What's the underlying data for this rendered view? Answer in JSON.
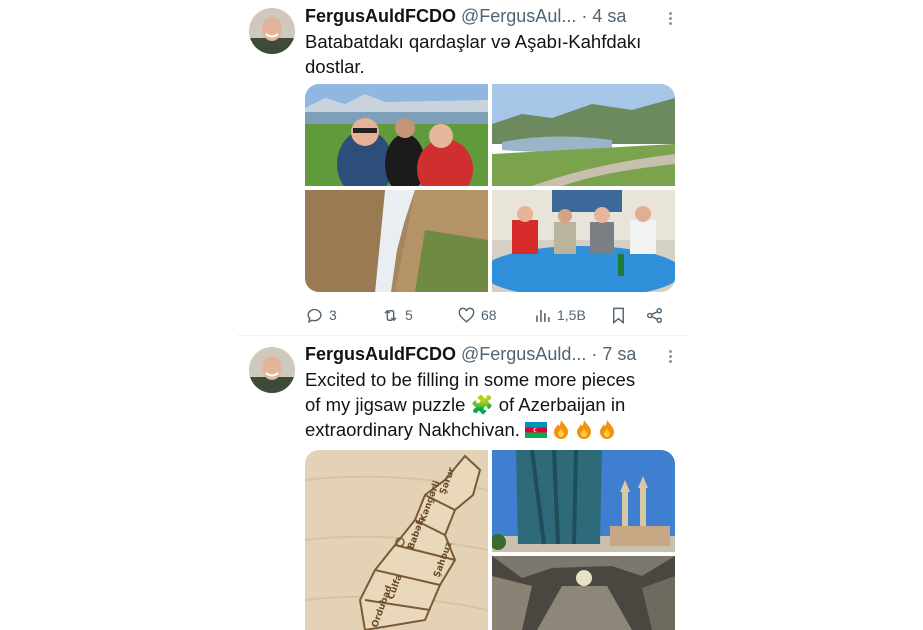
{
  "tweets": [
    {
      "author": "FergusAuldFCDO",
      "handle": "@FergusAul...",
      "separator": "·",
      "time": "4 sa",
      "text_line1": "Batabatdakı qardaşlar və Aşabı-Kahfdakı",
      "text_line2": "dostlar.",
      "stats": {
        "replies": "3",
        "reposts": "5",
        "likes": "68",
        "views": "1,5B"
      }
    },
    {
      "author": "FergusAuldFCDO",
      "handle": "@FergusAuld...",
      "separator": "·",
      "time": "7 sa",
      "text_line1": "Excited to be filling in some more pieces",
      "text_line2_a": "of my jigsaw puzzle",
      "text_line2_emoji": "🧩",
      "text_line2_b": "of Azerbaijan in",
      "text_line3": "extraordinary Nakhchivan.",
      "map_labels": [
        "Şərur",
        "Kəngərli",
        "Babək",
        "Şahbuz",
        "Culfa",
        "Ordubad"
      ]
    }
  ],
  "icons": {
    "reply": "speech-bubble",
    "repost": "repost-arrows",
    "like": "heart",
    "views": "bar-chart",
    "bookmark": "bookmark",
    "share": "share-nodes",
    "more": "vertical-dots"
  },
  "colors": {
    "text": "#0f1419",
    "secondary": "#536471",
    "fire": "#f4900c",
    "flag_blue": "#0092bc",
    "flag_red": "#e4002b",
    "flag_green": "#00af50"
  }
}
